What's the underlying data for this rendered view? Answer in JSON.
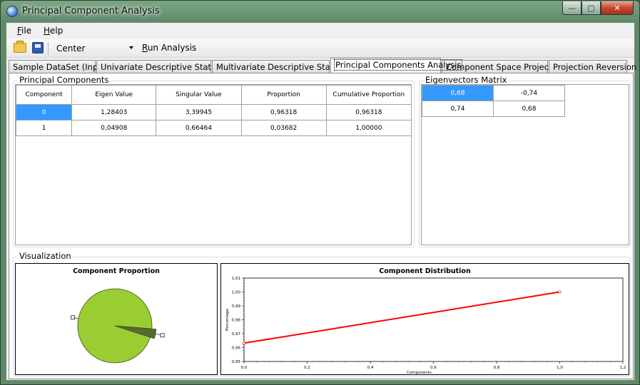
{
  "window": {
    "title": "Principal Component Analysis",
    "minimize": "—",
    "maximize": "▢",
    "close": "✕"
  },
  "menu": {
    "file": "File",
    "file_key": "F",
    "file_rest": "ile",
    "help": "Help",
    "help_key": "H",
    "help_rest": "elp"
  },
  "toolbar": {
    "method": "Center",
    "run_label": "Run Analysis",
    "run_key": "R",
    "run_rest": "un Analysis"
  },
  "tabs": [
    {
      "label": "Sample DataSet (Input)"
    },
    {
      "label": "Univariate Descriptive Statistics"
    },
    {
      "label": "Multivariate Descriptive Statistics"
    },
    {
      "label": "Principal Components Analysis",
      "active": true
    },
    {
      "label": "Component Space Projection"
    },
    {
      "label": "Projection Reversion"
    }
  ],
  "principal_components": {
    "title": "Principal Components",
    "columns": [
      "Component",
      "Eigen Value",
      "Singular Value",
      "Proportion",
      "Cumulative Proportion"
    ],
    "rows": [
      [
        "0",
        "1,28403",
        "3,39945",
        "0,96318",
        "0,96318"
      ],
      [
        "1",
        "0,04908",
        "0,66464",
        "0,03682",
        "1,00000"
      ]
    ]
  },
  "eigenvectors": {
    "title": "Eigenvectors Matrix",
    "rows": [
      [
        "0,68",
        "-0,74"
      ],
      [
        "0,74",
        "0,68"
      ]
    ]
  },
  "visualization": {
    "title": "Visualization"
  },
  "chart_data": [
    {
      "type": "pie",
      "title": "Component Proportion",
      "labels": [
        "0",
        "1"
      ],
      "values": [
        0.96318,
        0.03682
      ],
      "colors": [
        "#9acd32",
        "#556b2f"
      ]
    },
    {
      "type": "line",
      "title": "Component Distribution",
      "xlabel": "Components",
      "ylabel": "Percentage",
      "x": [
        0,
        1
      ],
      "y": [
        0.96318,
        1.0
      ],
      "xlim": [
        0,
        1.2
      ],
      "ylim": [
        0.95,
        1.01
      ],
      "xticks": [
        "0,0",
        "0,2",
        "0,4",
        "0,6",
        "0,8",
        "1,0",
        "1,2"
      ],
      "yticks": [
        "0,95",
        "0,96",
        "0,97",
        "0,98",
        "0,99",
        "1,00",
        "1,01"
      ],
      "color": "#ff0000"
    }
  ]
}
